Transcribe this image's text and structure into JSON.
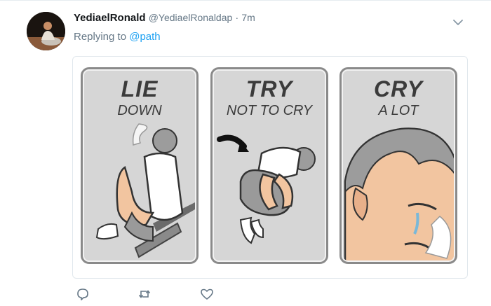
{
  "tweet": {
    "display_name": "YediaelRonald",
    "handle": "@YediaelRonaldap",
    "separator": "·",
    "time": "7m",
    "reply_prefix": "Replying to ",
    "reply_to": "@path"
  },
  "meme": {
    "panels": [
      {
        "big": "LIE",
        "small": "DOWN"
      },
      {
        "big": "TRY",
        "small": "NOT TO CRY"
      },
      {
        "big": "CRY",
        "small": "A LOT"
      }
    ]
  },
  "icons": {
    "caret": "chevron-down-icon",
    "reply": "reply-icon",
    "retweet": "retweet-icon",
    "like": "heart-icon"
  },
  "colors": {
    "link": "#1da1f2",
    "muted": "#657786",
    "text": "#14171a"
  }
}
